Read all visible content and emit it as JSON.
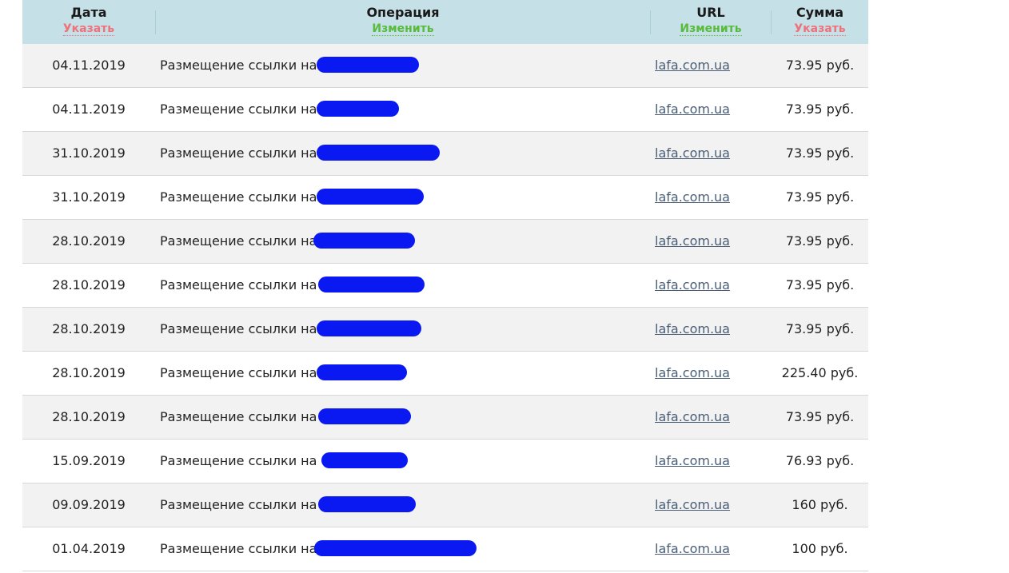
{
  "header": {
    "date": {
      "title": "Дата",
      "action": "Указать"
    },
    "operation": {
      "title": "Операция",
      "action": "Изменить"
    },
    "url": {
      "title": "URL",
      "action": "Изменить"
    },
    "sum": {
      "title": "Сумма",
      "action": "Указать"
    }
  },
  "colors": {
    "header_bg": "#c5e0e7",
    "action_red": "#f0717a",
    "action_green": "#57bb3b",
    "redaction": "#0a19f2",
    "link": "#4a5e77"
  },
  "rows": [
    {
      "date": "04.11.2019",
      "operation": "Размещение ссылки на",
      "url": "lafa.com.ua",
      "sum": "73.95 руб."
    },
    {
      "date": "04.11.2019",
      "operation": "Размещение ссылки на",
      "url": "lafa.com.ua",
      "sum": "73.95 руб."
    },
    {
      "date": "31.10.2019",
      "operation": "Размещение ссылки на",
      "url": "lafa.com.ua",
      "sum": "73.95 руб."
    },
    {
      "date": "31.10.2019",
      "operation": "Размещение ссылки на",
      "url": "lafa.com.ua",
      "sum": "73.95 руб."
    },
    {
      "date": "28.10.2019",
      "operation": "Размещение ссылки на",
      "url": "lafa.com.ua",
      "sum": "73.95 руб."
    },
    {
      "date": "28.10.2019",
      "operation": "Размещение ссылки на",
      "url": "lafa.com.ua",
      "sum": "73.95 руб."
    },
    {
      "date": "28.10.2019",
      "operation": "Размещение ссылки на",
      "url": "lafa.com.ua",
      "sum": "73.95 руб."
    },
    {
      "date": "28.10.2019",
      "operation": "Размещение ссылки на",
      "url": "lafa.com.ua",
      "sum": "225.40 руб."
    },
    {
      "date": "28.10.2019",
      "operation": "Размещение ссылки на",
      "url": "lafa.com.ua",
      "sum": "73.95 руб."
    },
    {
      "date": "15.09.2019",
      "operation": "Размещение ссылки на",
      "url": "lafa.com.ua",
      "sum": "76.93 руб."
    },
    {
      "date": "09.09.2019",
      "operation": "Размещение ссылки на",
      "url": "lafa.com.ua",
      "sum": "160 руб."
    },
    {
      "date": "01.04.2019",
      "operation": "Размещение ссылки на",
      "url": "lafa.com.ua",
      "sum": "100 руб."
    }
  ]
}
